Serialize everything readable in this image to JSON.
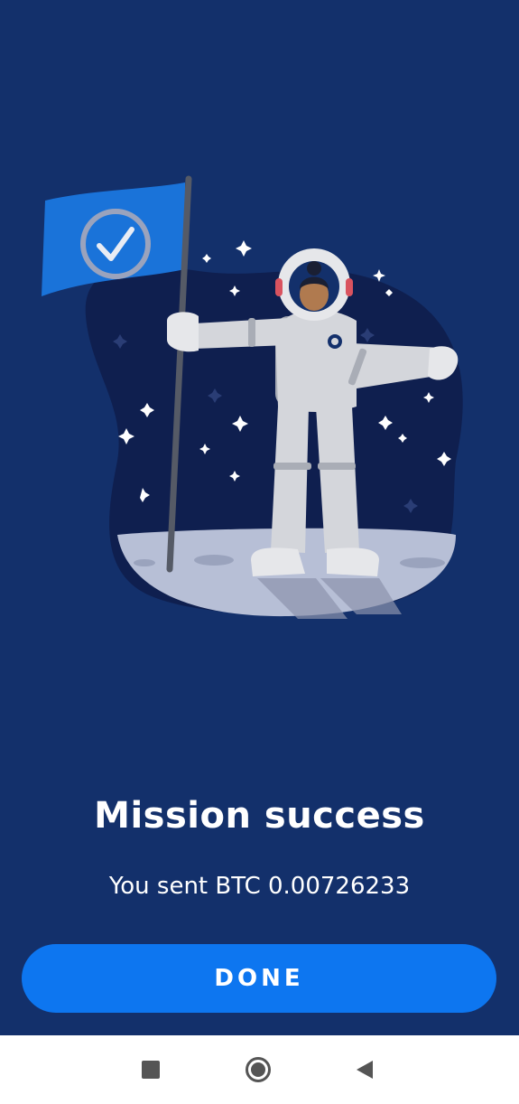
{
  "screen": {
    "title": "Mission success",
    "subtitle": "You sent BTC 0.00726233",
    "done_label": "DONE"
  },
  "illustration": {
    "name": "astronaut-with-flag",
    "icons": [
      "checkmark-flag-icon",
      "astronaut-icon",
      "moon-surface",
      "star-icon"
    ]
  },
  "navbar": {
    "items": [
      {
        "name": "recent-apps-icon"
      },
      {
        "name": "home-icon"
      },
      {
        "name": "back-icon"
      }
    ]
  },
  "colors": {
    "background": "#13306b",
    "button": "#0d76f0",
    "flag": "#1a73d9",
    "blob": "#0f1f4f",
    "moon": "#b7bfd6",
    "suit": "#d4d6db"
  }
}
